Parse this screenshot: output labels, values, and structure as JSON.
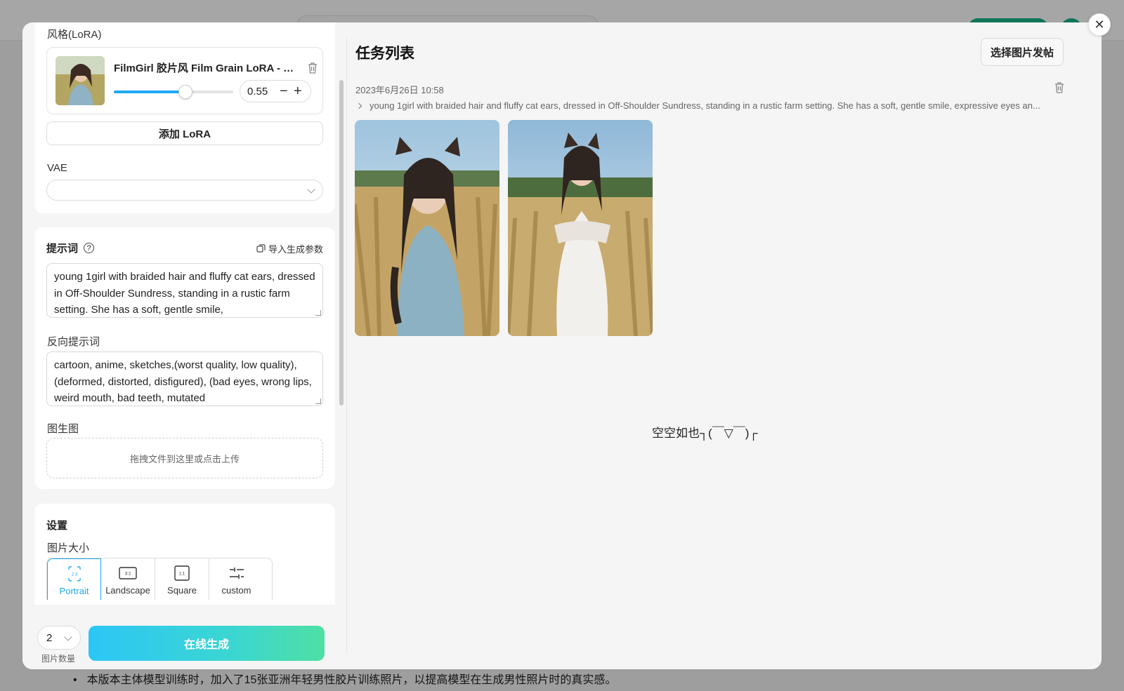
{
  "lora": {
    "section_label": "风格(LoRA)",
    "item_title": "FilmGirl 胶片风 Film Grain LoRA - V...",
    "weight_value": "0.55",
    "weight_fraction": 0.6,
    "add_button": "添加 LoRA",
    "minus": "−",
    "plus": "+"
  },
  "vae": {
    "label": "VAE",
    "selected": ""
  },
  "prompt": {
    "label": "提示词",
    "help": "?",
    "import_label": "导入生成参数",
    "text": "young 1girl with braided hair and fluffy cat ears, dressed in Off-Shoulder Sundress, standing in a rustic farm setting. She has a soft, gentle smile,",
    "negative_label": "反向提示词",
    "negative_text": "cartoon, anime, sketches,(worst quality, low quality), (deformed, distorted, disfigured), (bad eyes, wrong lips, weird mouth, bad teeth, mutated"
  },
  "img2img": {
    "label": "图生图",
    "upload_hint": "拖拽文件到这里或点击上传"
  },
  "settings": {
    "title": "设置",
    "size_label": "图片大小",
    "sizes": [
      {
        "label": "Portrait",
        "icon": "2:3"
      },
      {
        "label": "Landscape",
        "icon": "3:2"
      },
      {
        "label": "Square",
        "icon": "1:1"
      },
      {
        "label": "custom",
        "icon": "sliders-icon"
      }
    ],
    "active_size": "Portrait"
  },
  "bottom": {
    "count_value": "2",
    "count_label": "图片数量",
    "generate_button": "在线生成"
  },
  "tasks": {
    "title": "任务列表",
    "post_button": "选择图片发帖",
    "items": [
      {
        "time": "2023年6月26日 10:58",
        "prompt": "young 1girl with braided hair and fluffy cat ears, dressed in Off-Shoulder Sundress, standing in a rustic farm setting. She has a soft, gentle smile, expressive eyes an..."
      }
    ],
    "empty_text": "空空如也┐(￣▽￣)┌"
  },
  "background": {
    "footer_text": "本版本主体模型训练时，加入了15张亚洲年轻男性胶片训练照片，以提高模型在生成男性照片时的真实感。"
  },
  "colors": {
    "accent": "#1fa8f0",
    "generate_start": "#2cc6f6",
    "generate_end": "#4fdfa4"
  }
}
